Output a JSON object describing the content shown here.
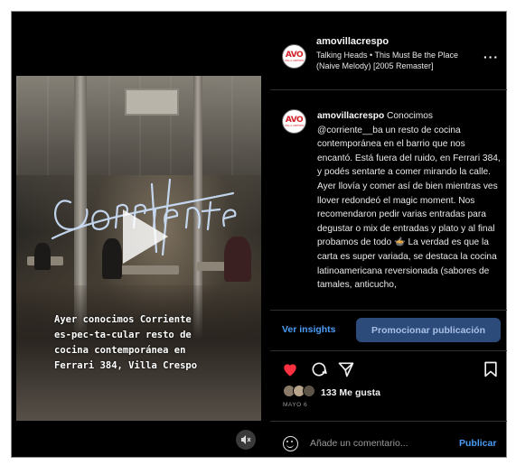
{
  "post": {
    "username": "amovillacrespo",
    "audio": "Talking Heads • This Must Be the Place (Naive Melody) [2005 Remaster]",
    "avatar_top": "AVO",
    "avatar_bottom": "VILLA CRESPO",
    "caption_lines": [
      "Ayer conocimos Corriente",
      "es-pec-ta-cular resto de",
      "cocina contemporánea en",
      "Ferrari 384, Villa Crespo"
    ],
    "body": {
      "author": "amovillacrespo",
      "text": "Conocimos @corriente__ba un resto de cocina contemporánea en el barrio que nos encantó. Está fuera del ruido, en Ferrari 384, y podés sentarte a comer mirando la calle. Ayer llovía y comer así de bien mientras ves llover redondeó el magic moment. Nos recomendaron pedir varias entradas para degustar o mix de entradas y plato y al final probamos de todo 🍲 La verdad es que la carta es super variada, se destaca la cocina latinoamericana reversionada (sabores de tamales, anticucho,"
    }
  },
  "actions": {
    "insights_label": "Ver insights",
    "promote_label": "Promocionar publicación"
  },
  "likes": {
    "count_label": "133 Me gusta",
    "date": "MAYO 6"
  },
  "comment": {
    "placeholder": "Añade un comentario...",
    "publish_label": "Publicar"
  },
  "colors": {
    "like_red": "#ff3040",
    "link_blue": "#4a9df8",
    "brand_red": "#d3222a"
  },
  "icons": [
    "heart-icon",
    "comment-icon",
    "share-icon",
    "bookmark-icon",
    "emoji-icon",
    "mute-icon",
    "more-options-icon",
    "play-icon"
  ]
}
